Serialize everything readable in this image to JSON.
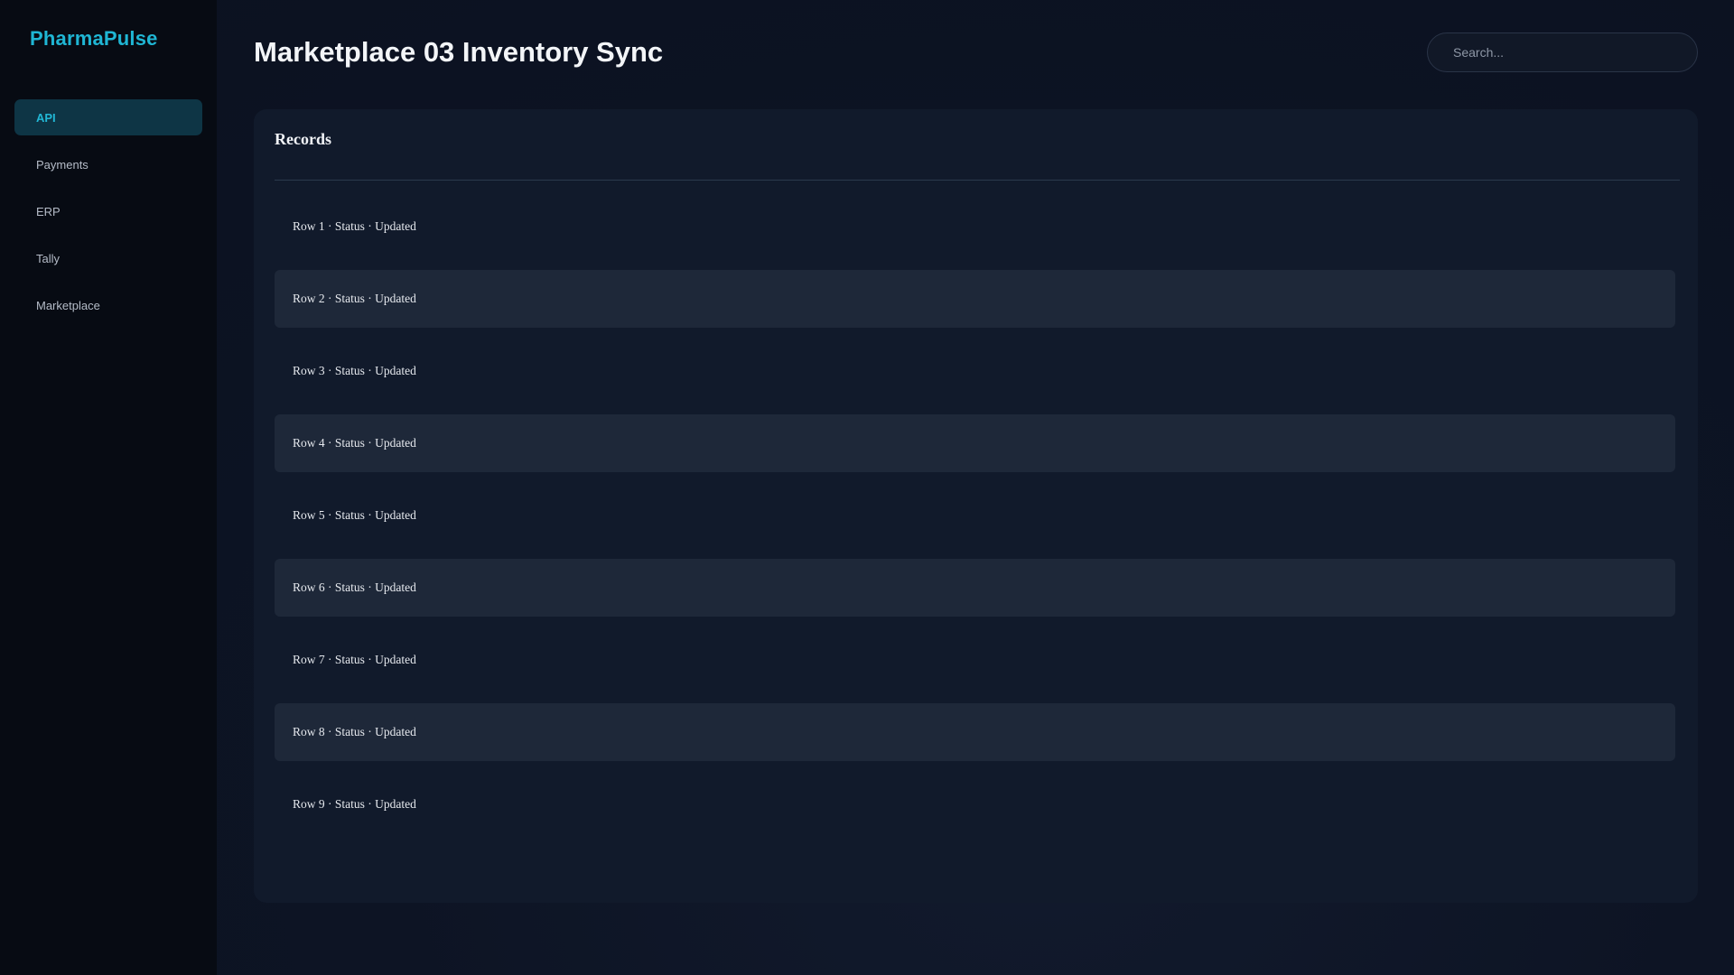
{
  "app": {
    "brand": "PharmaPulse"
  },
  "sidebar": {
    "items": [
      {
        "label": "API",
        "active": true
      },
      {
        "label": "Payments",
        "active": false
      },
      {
        "label": "ERP",
        "active": false
      },
      {
        "label": "Tally",
        "active": false
      },
      {
        "label": "Marketplace",
        "active": false
      }
    ]
  },
  "header": {
    "title": "Marketplace 03 Inventory Sync",
    "search_placeholder": "Search..."
  },
  "panel": {
    "title": "Records",
    "rows": [
      {
        "text": "Row 1 · Status · Updated"
      },
      {
        "text": "Row 2 · Status · Updated"
      },
      {
        "text": "Row 3 · Status · Updated"
      },
      {
        "text": "Row 4 · Status · Updated"
      },
      {
        "text": "Row 5 · Status · Updated"
      },
      {
        "text": "Row 6 · Status · Updated"
      },
      {
        "text": "Row 7 · Status · Updated"
      },
      {
        "text": "Row 8 · Status · Updated"
      },
      {
        "text": "Row 9 · Status · Updated"
      }
    ]
  },
  "colors": {
    "accent": "#1fb6d4",
    "active_nav_bg": "#0e3545",
    "sidebar_bg": "#070b13",
    "panel_bg": "#111a2b",
    "row_alt_bg": "#1e2839"
  }
}
